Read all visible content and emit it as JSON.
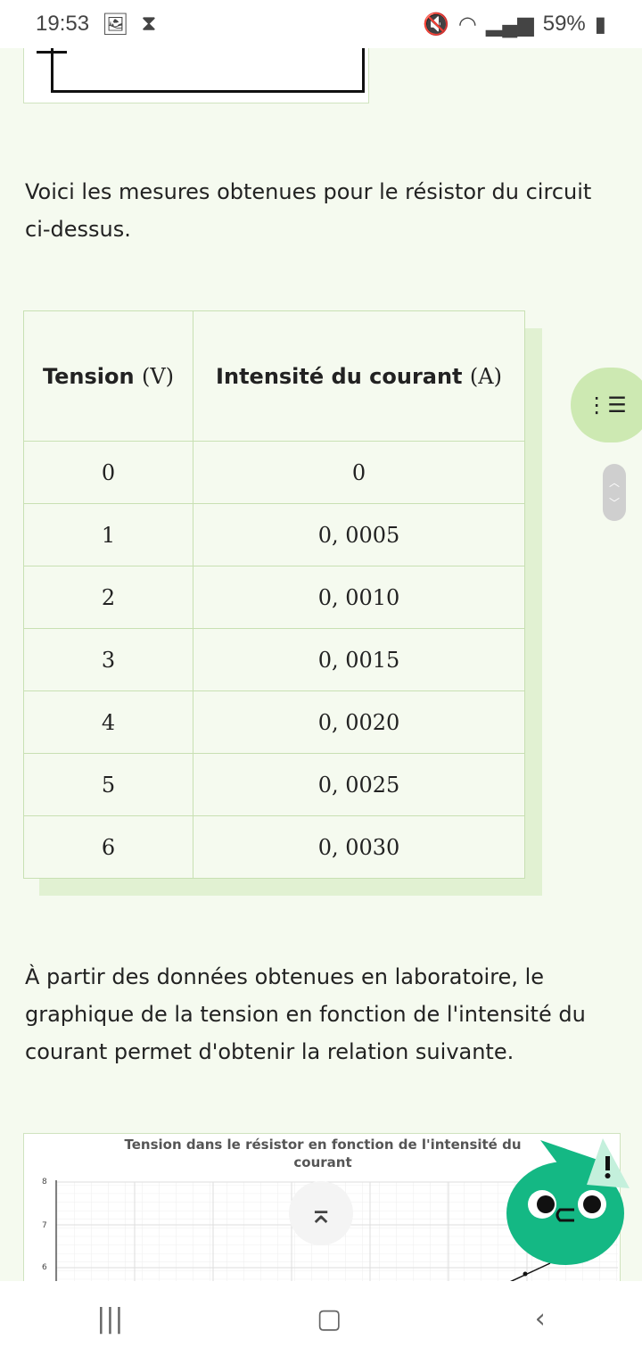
{
  "status_bar": {
    "time": "19:53",
    "battery": "59%",
    "icons": [
      "gallery-icon",
      "hourglass-icon",
      "mute-icon",
      "wifi-icon",
      "signal-icon",
      "battery-icon"
    ]
  },
  "intro_text": "Voici les mesures obtenues pour le résistor du circuit ci-dessus.",
  "table": {
    "headers": [
      {
        "label": "Tension",
        "unit": "(V)"
      },
      {
        "label": "Intensité du courant",
        "unit": "(A)"
      }
    ],
    "rows": [
      [
        "0",
        "0"
      ],
      [
        "1",
        "0, 0005"
      ],
      [
        "2",
        "0, 0010"
      ],
      [
        "3",
        "0, 0015"
      ],
      [
        "4",
        "0, 0020"
      ],
      [
        "5",
        "0, 0025"
      ],
      [
        "6",
        "0, 0030"
      ]
    ]
  },
  "graph_text": "À partir des données obtenues en laboratoire, le graphique de la tension en fonction de l'intensité du courant permet d'obtenir la relation suivante.",
  "chart": {
    "title": "Tension dans le résistor en fonction de l'intensité du courant",
    "y_ticks": [
      "8",
      "7",
      "6"
    ]
  },
  "colors": {
    "background": "#f5faef",
    "accent": "#cde9b2",
    "mascot": "#14b884"
  }
}
